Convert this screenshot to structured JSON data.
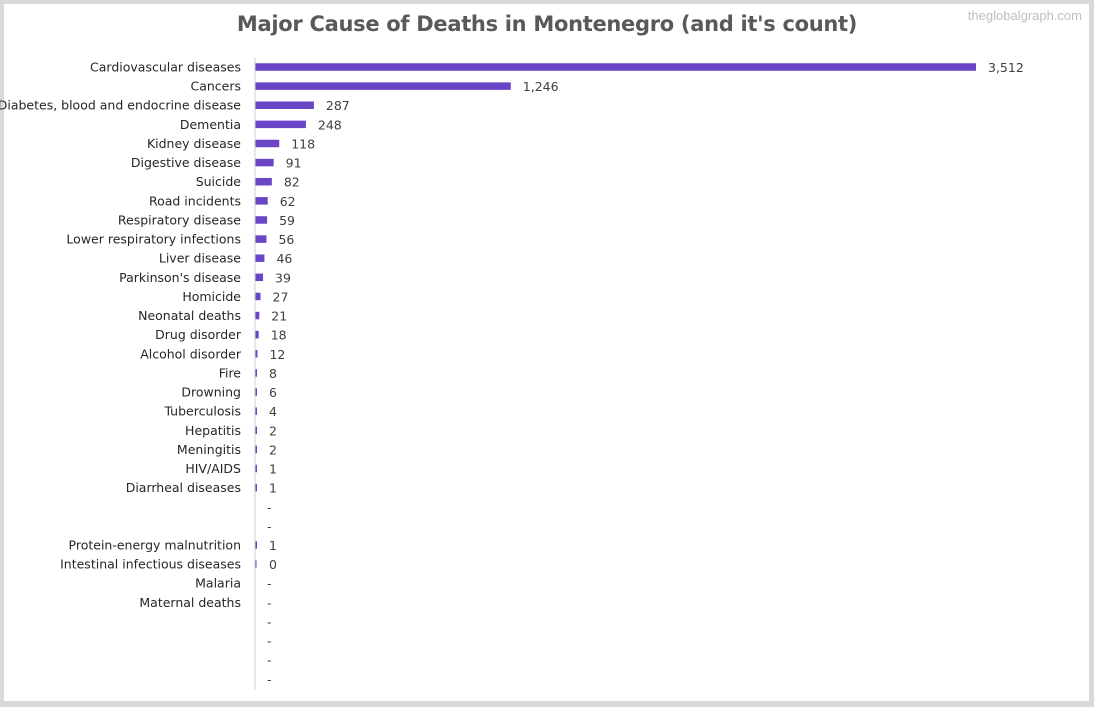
{
  "watermark": "theglobalgraph.com",
  "chart_data": {
    "type": "bar",
    "orientation": "horizontal",
    "title": "Major Cause of Deaths in Montenegro (and it's count)",
    "xlabel": "",
    "ylabel": "",
    "grid": false,
    "legend": "none",
    "bar_color": "#6a46c7",
    "xlim": [
      0,
      3512
    ],
    "categories": [
      "Cardiovascular diseases",
      "Cancers",
      "Diabetes, blood and endocrine disease",
      "Dementia",
      "Kidney disease",
      "Digestive disease",
      "Suicide",
      "Road incidents",
      "Respiratory disease",
      "Lower respiratory infections",
      "Liver disease",
      "Parkinson's disease",
      "Homicide",
      "Neonatal deaths",
      "Drug disorder",
      "Alcohol disorder",
      "Fire",
      "Drowning",
      "Tuberculosis",
      "Hepatitis",
      "Meningitis",
      "HIV/AIDS",
      "Diarrheal diseases",
      "",
      "",
      "Protein-energy malnutrition",
      "Intestinal infectious diseases",
      "Malaria",
      "Maternal deaths",
      "",
      "",
      "",
      ""
    ],
    "values": [
      3512,
      1246,
      287,
      248,
      118,
      91,
      82,
      62,
      59,
      56,
      46,
      39,
      27,
      21,
      18,
      12,
      8,
      6,
      4,
      2,
      2,
      1,
      1,
      null,
      null,
      1,
      0,
      null,
      null,
      null,
      null,
      null,
      null
    ],
    "value_labels": [
      "3,512",
      "1,246",
      "287",
      "248",
      "118",
      "91",
      "82",
      "62",
      "59",
      "56",
      "46",
      "39",
      "27",
      "21",
      "18",
      "12",
      "8",
      "6",
      "4",
      "2",
      "2",
      "1",
      "1",
      "-",
      "-",
      "1",
      "0",
      "-",
      "-",
      "-",
      "-",
      "-",
      "-"
    ]
  }
}
